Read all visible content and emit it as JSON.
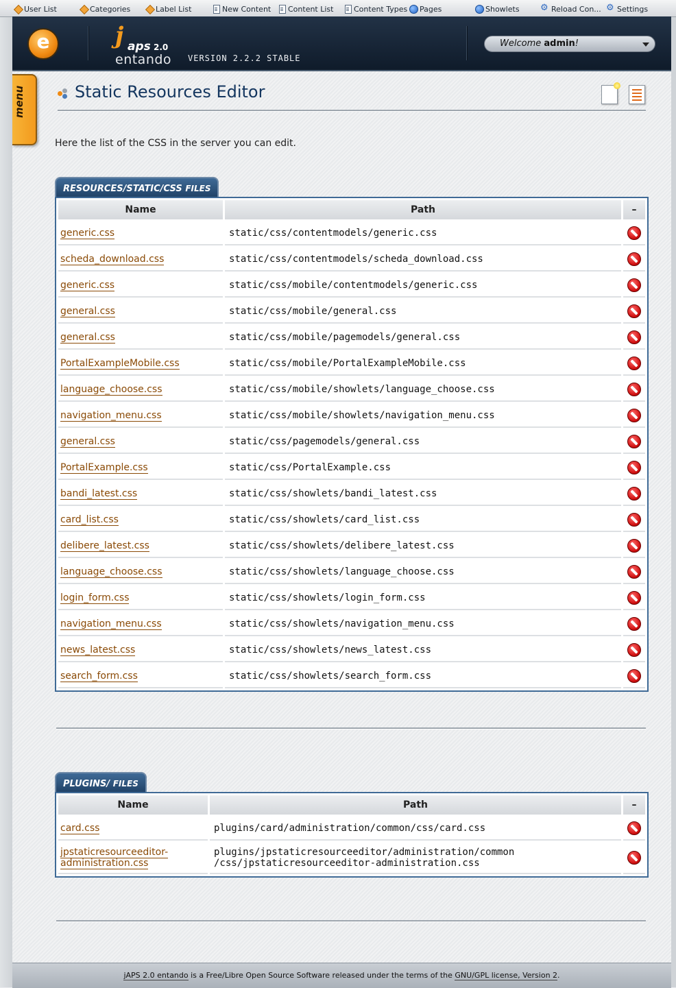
{
  "toolbar": {
    "items": [
      {
        "label": "User List",
        "icon": "diamond-icon"
      },
      {
        "label": "Categories",
        "icon": "diamond-icon"
      },
      {
        "label": "Label List",
        "icon": "diamond-icon"
      },
      {
        "label": "New Content",
        "icon": "document-icon"
      },
      {
        "label": "Content List",
        "icon": "document-icon"
      },
      {
        "label": "Content Types",
        "icon": "document-icon"
      },
      {
        "label": "Pages",
        "icon": "globe-icon"
      },
      {
        "label": "Showlets",
        "icon": "globe-icon"
      },
      {
        "label": "Reload Con...",
        "icon": "gear-icon"
      },
      {
        "label": "Settings",
        "icon": "gear-icon"
      }
    ]
  },
  "header": {
    "logo_letter": "e",
    "brand_i": "j",
    "brand_aps": "aps",
    "brand_version": "2.0",
    "brand_name": "entando",
    "version_label": "VERSION 2.2.2 STABLE",
    "welcome_text": "Welcome",
    "welcome_user": "admin",
    "welcome_suffix": "!"
  },
  "menu_tab": {
    "label": "menu"
  },
  "page": {
    "title": "Static Resources Editor",
    "intro": "Here the list of the CSS in the server you can edit."
  },
  "sections": [
    {
      "tab_prefix": "RESOURCES/STATIC/CSS",
      "tab_suffix": "FILES",
      "headers": {
        "name": "Name",
        "path": "Path",
        "action": "–"
      },
      "rows": [
        {
          "name": "generic.css",
          "path": "static/css/contentmodels/generic.css"
        },
        {
          "name": "scheda_download.css",
          "path": "static/css/contentmodels/scheda_download.css"
        },
        {
          "name": "generic.css",
          "path": "static/css/mobile/contentmodels/generic.css"
        },
        {
          "name": "general.css",
          "path": "static/css/mobile/general.css"
        },
        {
          "name": "general.css",
          "path": "static/css/mobile/pagemodels/general.css"
        },
        {
          "name": "PortalExampleMobile.css",
          "path": "static/css/mobile/PortalExampleMobile.css"
        },
        {
          "name": "language_choose.css",
          "path": "static/css/mobile/showlets/language_choose.css"
        },
        {
          "name": "navigation_menu.css",
          "path": "static/css/mobile/showlets/navigation_menu.css"
        },
        {
          "name": "general.css",
          "path": "static/css/pagemodels/general.css"
        },
        {
          "name": "PortalExample.css",
          "path": "static/css/PortalExample.css"
        },
        {
          "name": "bandi_latest.css",
          "path": "static/css/showlets/bandi_latest.css"
        },
        {
          "name": "card_list.css",
          "path": "static/css/showlets/card_list.css"
        },
        {
          "name": "delibere_latest.css",
          "path": "static/css/showlets/delibere_latest.css"
        },
        {
          "name": "language_choose.css",
          "path": "static/css/showlets/language_choose.css"
        },
        {
          "name": "login_form.css",
          "path": "static/css/showlets/login_form.css"
        },
        {
          "name": "navigation_menu.css",
          "path": "static/css/showlets/navigation_menu.css"
        },
        {
          "name": "news_latest.css",
          "path": "static/css/showlets/news_latest.css"
        },
        {
          "name": "search_form.css",
          "path": "static/css/showlets/search_form.css"
        }
      ]
    },
    {
      "tab_prefix": "PLUGINS/",
      "tab_suffix": "FILES",
      "headers": {
        "name": "Name",
        "path": "Path",
        "action": "–"
      },
      "rows": [
        {
          "name": "card.css",
          "path": "plugins/card/administration/common/css/card.css"
        },
        {
          "name": "jpstaticresourceeditor-administration.css",
          "name_line1": "jpstaticresourceeditor-",
          "name_line2": "administration.css",
          "path_line1": "plugins/jpstaticresourceeditor/administration/common",
          "path_line2": "/css/jpstaticresourceeditor-administration.css"
        }
      ]
    }
  ],
  "footer": {
    "product_link": "jAPS 2.0 entando",
    "middle_text": " is a Free/Libre Open Source Software released under the terms of the ",
    "license_link": "GNU/GPL license, Version 2",
    "end_text": "."
  }
}
